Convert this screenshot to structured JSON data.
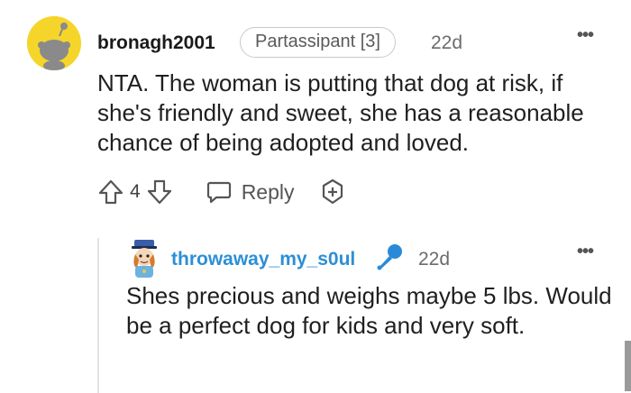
{
  "comment": {
    "username": "bronagh2001",
    "flair": "Partassipant [3]",
    "age": "22d",
    "more": "•••",
    "body": "NTA. The woman is putting that dog at risk, if she's friendly and sweet, she has a reasonable chance of being adopted and loved.",
    "score": "4",
    "reply_label": "Reply",
    "avatar_color": "#f5d52a"
  },
  "reply": {
    "username": "throwaway_my_s0ul",
    "age": "22d",
    "more": "•••",
    "body": "Shes precious and weighs maybe 5 lbs. Would be a perfect dog for kids and very soft.",
    "username_color": "#2c8fd6",
    "mic_color": "#2a8ad8"
  }
}
